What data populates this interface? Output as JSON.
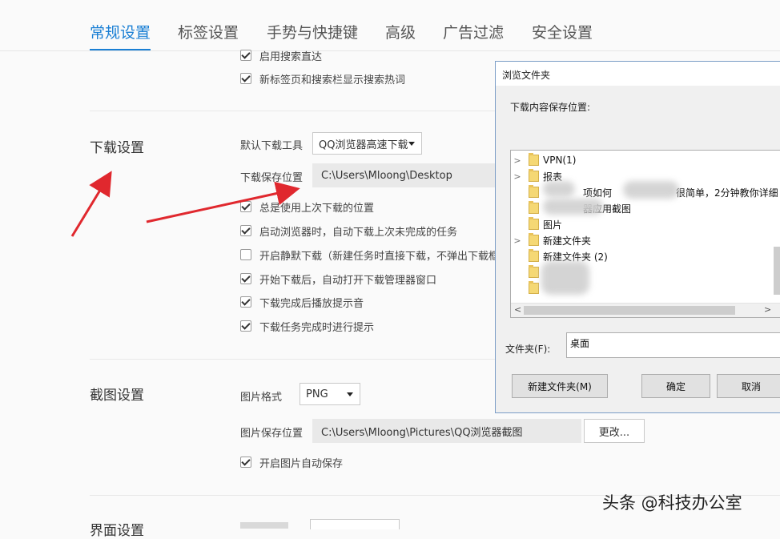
{
  "tabs": [
    {
      "label": "常规设置",
      "active": true
    },
    {
      "label": "标签设置",
      "active": false
    },
    {
      "label": "手势与快捷键",
      "active": false
    },
    {
      "label": "高级",
      "active": false
    },
    {
      "label": "广告过滤",
      "active": false
    },
    {
      "label": "安全设置",
      "active": false
    }
  ],
  "search_options": [
    {
      "label": "启用搜索直达",
      "checked": true
    },
    {
      "label": "新标签页和搜索栏显示搜索热词",
      "checked": true
    }
  ],
  "download": {
    "title": "下载设置",
    "tool_label": "默认下载工具",
    "tool_value": "QQ浏览器高速下载",
    "path_label": "下载保存位置",
    "path_value": "C:\\Users\\Mloong\\Desktop",
    "options": [
      {
        "label": "总是使用上次下载的位置",
        "checked": true
      },
      {
        "label": "启动浏览器时，自动下载上次未完成的任务",
        "checked": true
      },
      {
        "label": "开启静默下载（新建任务时直接下载，不弹出下载框）",
        "checked": false
      },
      {
        "label": "开始下载后，自动打开下载管理器窗口",
        "checked": true
      },
      {
        "label": "下载完成后播放提示音",
        "checked": true
      },
      {
        "label": "下载任务完成时进行提示",
        "checked": true
      }
    ]
  },
  "screenshot": {
    "title": "截图设置",
    "format_label": "图片格式",
    "format_value": "PNG",
    "path_label": "图片保存位置",
    "path_value": "C:\\Users\\Mloong\\Pictures\\QQ浏览器截图",
    "change_button": "更改...",
    "autosave": {
      "label": "开启图片自动保存",
      "checked": true
    }
  },
  "next_section_title": "界面设置",
  "dialog": {
    "title": "浏览文件夹",
    "prompt": "下载内容保存位置:",
    "tree": [
      {
        "label": "VPN(1)",
        "expandable": true
      },
      {
        "label": "报表",
        "expandable": true
      },
      {
        "label": "项如何",
        "expandable": false
      },
      {
        "label": "器应用截图",
        "expandable": false
      },
      {
        "label": "图片",
        "expandable": false
      },
      {
        "label": "新建文件夹",
        "expandable": true
      },
      {
        "label": "新建文件夹 (2)",
        "expandable": false
      },
      {
        "label": "",
        "expandable": false
      },
      {
        "label": "",
        "expandable": false
      }
    ],
    "tree_extra_text": "很简单，2分钟教你详细",
    "folder_label": "文件夹(F):",
    "folder_value": "桌面",
    "new_folder_button": "新建文件夹(M)",
    "ok_button": "确定",
    "cancel_button": "取消"
  },
  "watermark": "头条 @科技办公室",
  "colors": {
    "accent": "#1a7fd4",
    "arrow": "#e0282e"
  }
}
